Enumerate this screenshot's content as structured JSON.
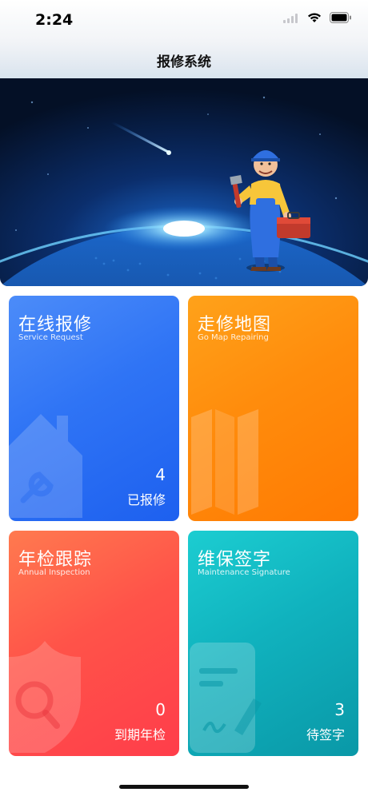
{
  "status": {
    "time": "2:24"
  },
  "nav": {
    "title": "报修系统"
  },
  "banner": {
    "alt": "repair-worker-earth-banner"
  },
  "cards": [
    {
      "title": "在线报修",
      "subtitle": "Service Request",
      "count": "",
      "label": "4",
      "caption": "已报修",
      "color": "#2f74f5",
      "icon": "house-wrench-icon"
    },
    {
      "title": "走修地图",
      "subtitle": "Go Map Repairing",
      "count": "",
      "label": "",
      "caption": "",
      "color": "#ff8c0c",
      "icon": "map-icon"
    },
    {
      "title": "年检跟踪",
      "subtitle": "Annual Inspection",
      "count": "",
      "label": "0",
      "caption": "到期年检",
      "color": "#ff5349",
      "icon": "shield-search-icon"
    },
    {
      "title": "维保签字",
      "subtitle": "Maintenance Signature",
      "count": "",
      "label": "3",
      "caption": "待签字",
      "color": "#10b2be",
      "icon": "document-signature-icon"
    }
  ]
}
